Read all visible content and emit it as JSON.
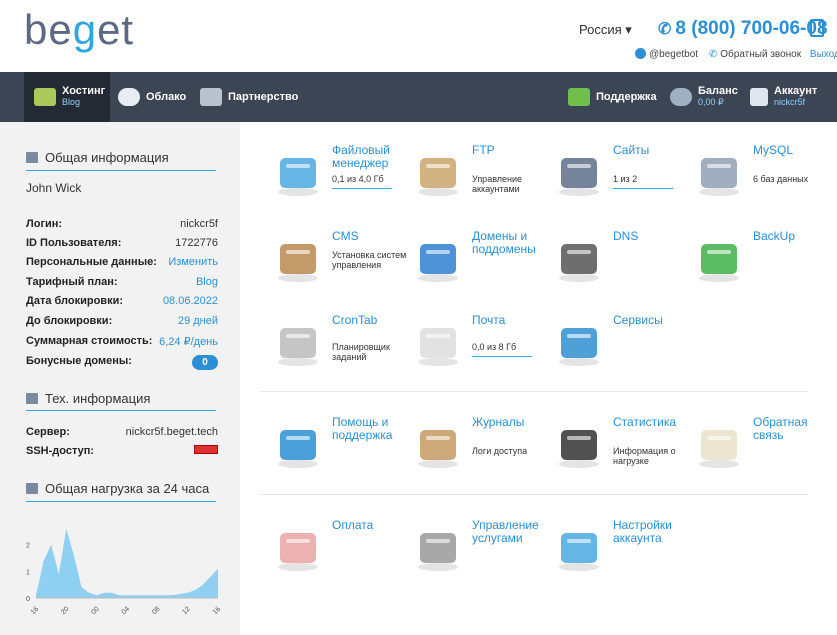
{
  "header": {
    "logo_pre": "be",
    "logo_g": "g",
    "logo_post": "et",
    "region": "Россия ▾",
    "phone": "8 (800) 700-06-08",
    "telegram": "@begetbot",
    "callback": "Обратный звонок",
    "exit": "Выход"
  },
  "nav": {
    "items": [
      {
        "label": "Хостинг",
        "sub": "Blog"
      },
      {
        "label": "Облако",
        "sub": ""
      },
      {
        "label": "Партнерство",
        "sub": ""
      },
      {
        "label": "Поддержка",
        "sub": ""
      },
      {
        "label": "Баланс",
        "sub": "0,00 ₽"
      },
      {
        "label": "Аккаунт",
        "sub": "nickcr5f"
      }
    ]
  },
  "sidebar": {
    "general_title": "Общая информация",
    "user_name": "John Wick",
    "rows": [
      {
        "label": "Логин:",
        "value": "nickcr5f"
      },
      {
        "label": "ID Пользователя:",
        "value": "1722776"
      },
      {
        "label": "Персональные данные:",
        "value": "Изменить"
      },
      {
        "label": "Тарифный план:",
        "value": "Blog"
      },
      {
        "label": "Дата блокировки:",
        "value": "08.06.2022"
      },
      {
        "label": "До блокировки:",
        "value": "29 дней"
      },
      {
        "label": "Суммарная стоимость:",
        "value": "6,24 ₽/день"
      },
      {
        "label": "Бонусные домены:",
        "value": "0"
      }
    ],
    "tech_title": "Тех. информация",
    "server_label": "Сервер:",
    "server_value": "nickcr5f.beget.tech",
    "ssh_label": "SSH-доступ:",
    "ssh_enabled": false,
    "load_title": "Общая нагрузка за 24 часа"
  },
  "tiles": [
    {
      "title": "Файловый менеджер",
      "desc": "0,1 из 4,0 Гб",
      "icon": "folder-icon",
      "color": "#4aa8e0"
    },
    {
      "title": "FTP",
      "desc": "Управление аккаунтами",
      "icon": "ftp-folder-icon",
      "color": "#c9a46a"
    },
    {
      "title": "Сайты",
      "desc": "1 из 2",
      "icon": "sites-stack-icon",
      "color": "#5d6f8a"
    },
    {
      "title": "MySQL",
      "desc": "6 баз данных",
      "icon": "database-icon",
      "color": "#8fa0b5"
    },
    {
      "title": "CMS",
      "desc": "Установка систем управления",
      "icon": "cms-box-icon",
      "color": "#b88a50"
    },
    {
      "title": "Домены и поддомены",
      "desc": "",
      "icon": "globe-keys-icon",
      "color": "#2f7fd0"
    },
    {
      "title": "DNS",
      "desc": "",
      "icon": "dns-globe-icon",
      "color": "#555"
    },
    {
      "title": "BackUp",
      "desc": "",
      "icon": "backup-icon",
      "color": "#3fb04a"
    },
    {
      "title": "CronTab",
      "desc": "Планировщик заданий",
      "icon": "clock-icon",
      "color": "#bbb"
    },
    {
      "title": "Почта",
      "desc": "0,0 из 8 Гб",
      "icon": "mail-icon",
      "color": "#ddd"
    },
    {
      "title": "Сервисы",
      "desc": "",
      "icon": "whale-icon",
      "color": "#2f8fd0"
    },
    {
      "title": "Помощь и поддержка",
      "desc": "",
      "icon": "help-bubbles-icon",
      "color": "#2a8fd4"
    },
    {
      "title": "Журналы",
      "desc": "Логи доступа",
      "icon": "logs-box-icon",
      "color": "#c49a62"
    },
    {
      "title": "Статистика",
      "desc": "Информация о нагрузке",
      "icon": "chart-board-icon",
      "color": "#333"
    },
    {
      "title": "Обратная связь",
      "desc": "",
      "icon": "feedback-pen-icon",
      "color": "#e9e2c8"
    },
    {
      "title": "Оплата",
      "desc": "",
      "icon": "piggy-bank-icon",
      "color": "#e9a5a5"
    },
    {
      "title": "Управление услугами",
      "desc": "",
      "icon": "services-column-icon",
      "color": "#999"
    },
    {
      "title": "Настройки аккаунта",
      "desc": "",
      "icon": "account-settings-icon",
      "color": "#4aa8e0"
    }
  ],
  "chart_data": {
    "type": "area",
    "x": [
      "16",
      "20",
      "00",
      "04",
      "08",
      "12",
      "16"
    ],
    "series": [
      {
        "values": [
          0.1,
          1.4,
          2.0,
          0.9,
          2.6,
          1.6,
          0.4,
          0.2,
          0.1,
          0.2,
          0.2,
          0.1,
          0.1,
          0.1,
          0.1,
          0.1,
          0.1,
          0.1,
          0.1,
          0.15,
          0.2,
          0.3,
          0.5,
          0.8,
          1.1
        ]
      }
    ],
    "y_ticks": [
      "0",
      "1",
      "2"
    ],
    "ylim": [
      0,
      3
    ],
    "color": "#8fd0f2"
  }
}
